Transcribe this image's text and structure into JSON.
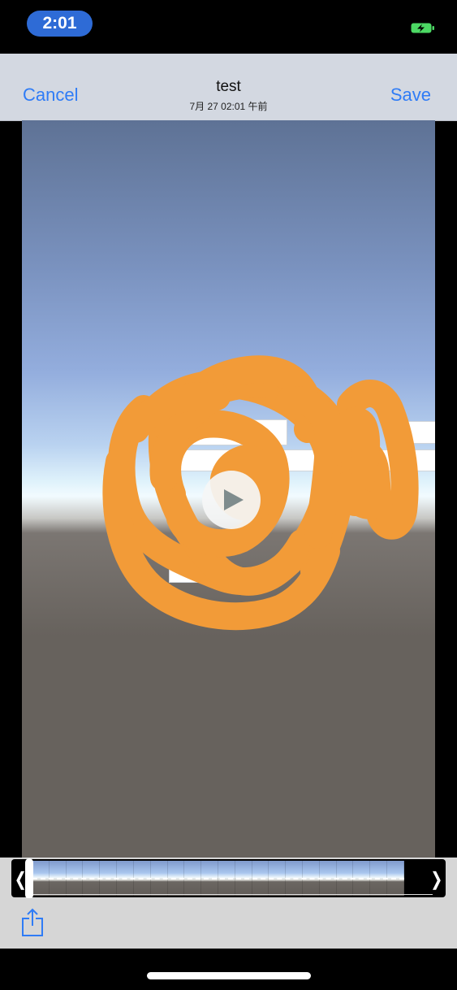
{
  "status": {
    "time": "2:01"
  },
  "nav": {
    "cancel_label": "Cancel",
    "save_label": "Save",
    "title": "test",
    "subtitle": "7月 27 02:01 午前"
  },
  "icons": {
    "battery": "battery-charging-icon",
    "play": "play-icon",
    "share": "share-icon",
    "trim_left": "chevron-left-icon",
    "trim_right": "chevron-right-icon"
  },
  "colors": {
    "accent": "#2f7cf6",
    "scribble": "#f29b38",
    "time_pill": "#2e6bd6",
    "battery": "#4cd964"
  },
  "trimmer": {
    "chevron_left": "❬",
    "chevron_right": "❭",
    "playhead_position": 0.0
  }
}
